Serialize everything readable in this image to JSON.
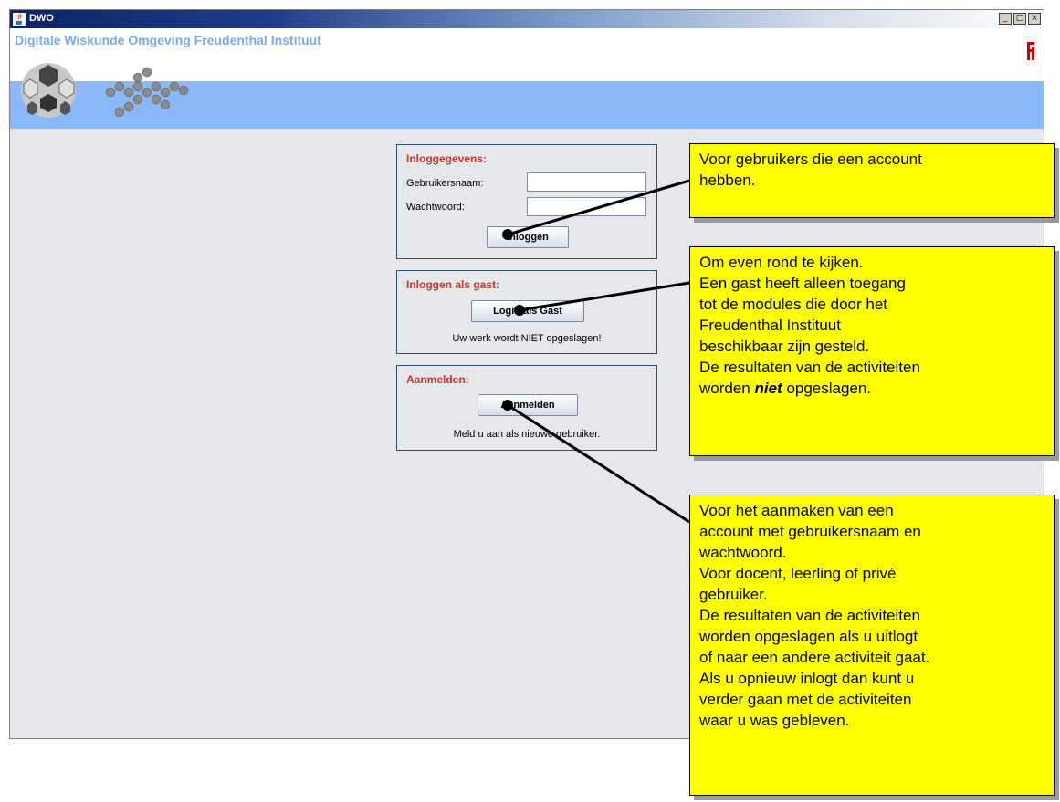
{
  "window": {
    "title": "DWO",
    "minimize_label": "_",
    "maximize_label": "□",
    "close_label": "×"
  },
  "header": {
    "app_title": "Digitale Wiskunde Omgeving  Freudenthal Instituut"
  },
  "login_panel": {
    "title": "Inloggegevens:",
    "username_label": "Gebruikersnaam:",
    "password_label": "Wachtwoord:",
    "username_value": "",
    "password_value": "",
    "login_button": "Inloggen"
  },
  "guest_panel": {
    "title": "Inloggen als gast:",
    "guest_button": "Login als Gast",
    "note": "Uw werk wordt NIET opgeslagen!"
  },
  "register_panel": {
    "title": "Aanmelden:",
    "register_button": "Aanmelden",
    "note": "Meld u aan als nieuwe gebruiker."
  },
  "callouts": {
    "account": [
      "Voor gebruikers die een account",
      "hebben."
    ],
    "guest": {
      "lines": [
        "Om even rond te kijken.",
        "Een gast heeft alleen toegang",
        "tot de modules die door het",
        "Freudenthal Instituut",
        "beschikbaar zijn gesteld.",
        "De resultaten van de activiteiten"
      ],
      "last_prefix": "worden ",
      "last_emphasis": "niet",
      "last_suffix": " opgeslagen."
    },
    "register": [
      "Voor het aanmaken van een",
      "account met gebruikersnaam en",
      "wachtwoord.",
      "Voor docent, leerling of privé",
      "gebruiker.",
      "De resultaten van de activiteiten",
      "worden opgeslagen als u uitlogt",
      "of naar een andere activiteit gaat.",
      "Als u opnieuw inlogt dan kunt u",
      "verder gaan met de activiteiten",
      "waar u was gebleven."
    ]
  },
  "colors": {
    "callout_bg": "#ffff00",
    "panel_title": "#c0392b",
    "band": "#8ab8f8"
  }
}
